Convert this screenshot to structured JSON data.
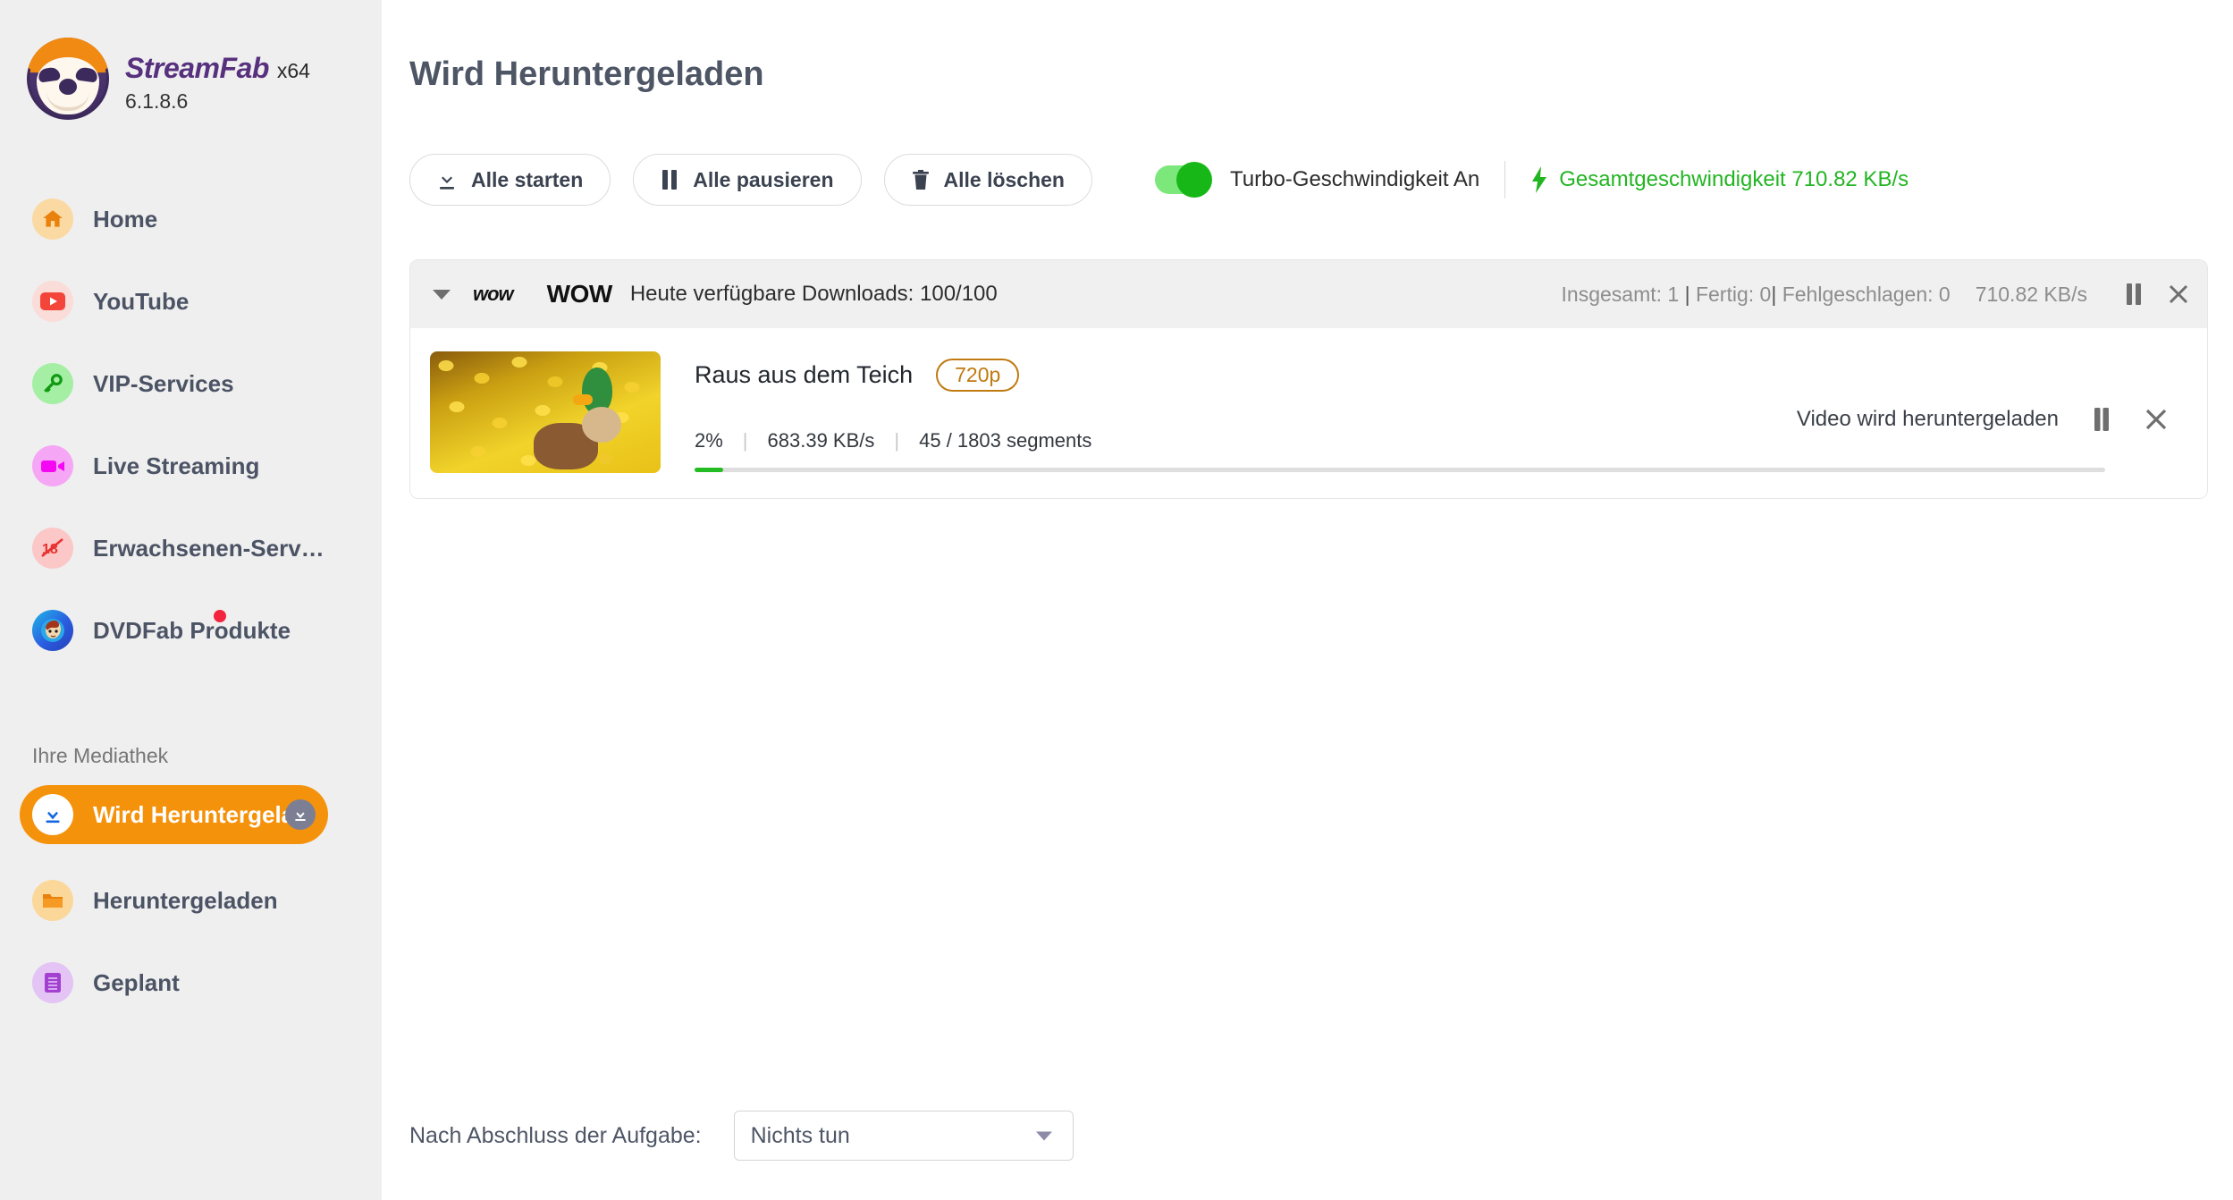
{
  "app": {
    "brand_name": "StreamFab",
    "architecture": "x64",
    "version": "6.1.8.6"
  },
  "window_controls": [
    {
      "name": "theme-shirt-icon",
      "icon": "tshirt-icon"
    },
    {
      "name": "menu-icon",
      "icon": "hamburger-icon"
    },
    {
      "name": "minimize-button",
      "icon": "minimize-icon"
    },
    {
      "name": "restore-button",
      "icon": "restore-icon"
    },
    {
      "name": "close-button",
      "icon": "close-icon"
    }
  ],
  "sidebar": {
    "items": [
      {
        "label": "Home",
        "icon": "home-icon",
        "icon_bg": "#fbd9a3",
        "icon_color": "#e8820c",
        "badge": false
      },
      {
        "label": "YouTube",
        "icon": "youtube-icon",
        "icon_bg": "#fadcd9",
        "icon_color": "#f4453a",
        "badge": false
      },
      {
        "label": "VIP-Services",
        "icon": "key-icon",
        "icon_bg": "#a5efa5",
        "icon_color": "#119a11",
        "badge": false
      },
      {
        "label": "Live Streaming",
        "icon": "video-camera-icon",
        "icon_bg": "#f5a7f5",
        "icon_color": "#f408f4",
        "badge": false
      },
      {
        "label": "Erwachsenen-Serv…",
        "icon": "adult-18-blocked-icon",
        "icon_bg": "#fbc7c7",
        "icon_color": "#e8322f",
        "badge": false
      },
      {
        "label": "DVDFab Produkte",
        "icon": "dvdfab-avatar-icon",
        "icon_bg": "#2a5ce0",
        "icon_color": "#ffffff",
        "badge": true
      }
    ],
    "section_title": "Ihre Mediathek",
    "library_items": [
      {
        "label": "Wird Heruntergela",
        "icon": "download-arrow-icon",
        "icon_bg": "#ffffff",
        "icon_color": "#1769e0",
        "active": true,
        "trailing_icon": "download-arrow-icon"
      },
      {
        "label": "Heruntergeladen",
        "icon": "folder-icon",
        "icon_bg": "#fcd79a",
        "icon_color": "#e8820c",
        "active": false
      },
      {
        "label": "Geplant",
        "icon": "schedule-list-icon",
        "icon_bg": "#e3c4f5",
        "icon_color": "#a33fd1",
        "active": false
      }
    ]
  },
  "main": {
    "page_title": "Wird Heruntergeladen",
    "toolbar": {
      "start_all_label": "Alle starten",
      "pause_all_label": "Alle pausieren",
      "delete_all_label": "Alle löschen",
      "turbo_label": "Turbo-Geschwindigkeit An",
      "turbo_on": true,
      "total_speed_label": "Gesamtgeschwindigkeit 710.82 KB/s",
      "accent_green": "#22b522"
    },
    "group": {
      "provider_short": "wow",
      "provider_name": "WOW",
      "quota_text": "Heute verfügbare Downloads: 100/100",
      "total_label": "Insgesamt: 1",
      "finished_label": "Fertig: 0",
      "failed_label": "Fehlgeschlagen: 0",
      "speed": "710.82 KB/s",
      "expanded": true
    },
    "items": [
      {
        "title": "Raus aus dem Teich",
        "quality_badge": "720p",
        "percent_label": "2%",
        "speed": "683.39 KB/s",
        "segments": "45 / 1803 segments",
        "status": "Video wird heruntergeladen",
        "progress_percent": 2
      }
    ],
    "bottom_bar": {
      "label": "Nach Abschluss der Aufgabe:",
      "select_value": "Nichts tun"
    }
  },
  "colors": {
    "sidebar_bg": "#efefef",
    "active_item": "#f5920b",
    "title_text": "#4e5666",
    "badge_orange": "#c07a10",
    "progress_green": "#23bd23"
  }
}
